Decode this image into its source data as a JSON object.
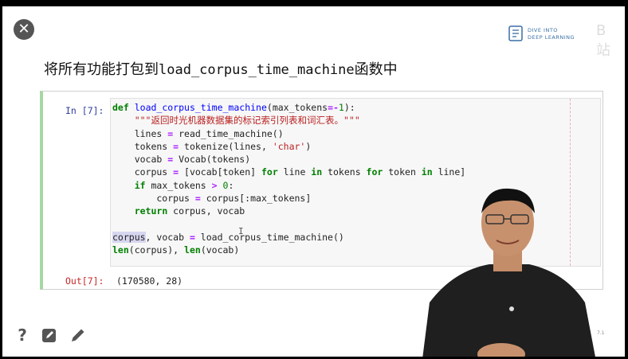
{
  "close_icon": "close-icon",
  "logo": {
    "line1": "DIVE INTO",
    "line2": "DEEP LEARNING",
    "watermark": "B站"
  },
  "title": {
    "prefix": "将所有功能打包到",
    "code": "load_corpus_time_machine",
    "suffix": "函数中"
  },
  "cell": {
    "in_prompt": "In [7]:",
    "out_prompt": "Out[7]:",
    "output": "(170580, 28)"
  },
  "nav": {
    "prev": "‹",
    "page": "7.1"
  },
  "tools": {
    "help_icon": "question-icon",
    "edit_icon": "edit-square-icon",
    "pen_icon": "pencil-icon"
  },
  "colors": {
    "keyword": "#008000",
    "string": "#ba2121",
    "cell_border": "#a6d8a3"
  }
}
